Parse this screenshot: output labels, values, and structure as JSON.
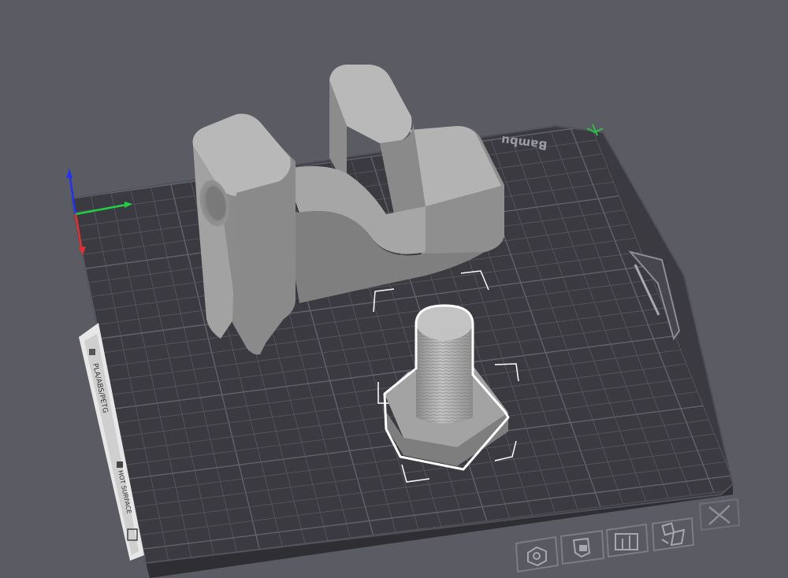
{
  "plate": {
    "brand": "Bambu",
    "sticker_filament_label": "PLA/ABS/PETG",
    "sticker_warning_label": "HOT SURFACE"
  },
  "colors": {
    "background": "#5b5b63",
    "plate": "#3a3a40",
    "grid": "#55555d",
    "model": "#8c8c8c",
    "selection_outline": "#ffffff",
    "axis_x": "#e03030",
    "axis_y": "#22cc44",
    "axis_z": "#2233ee"
  },
  "objects": [
    {
      "name": "U-shaped bracket",
      "selected": false
    },
    {
      "name": "Hex bolt",
      "selected": true
    }
  ],
  "toolbar": [
    {
      "icon": "hexagon-nut-icon",
      "tooltip": "Objects"
    },
    {
      "icon": "shield-lock-icon",
      "tooltip": "Lock"
    },
    {
      "icon": "arrange-icon",
      "tooltip": "Arrange"
    },
    {
      "icon": "orient-icon",
      "tooltip": "Auto orient"
    },
    {
      "icon": "close-icon",
      "tooltip": "Delete"
    }
  ]
}
